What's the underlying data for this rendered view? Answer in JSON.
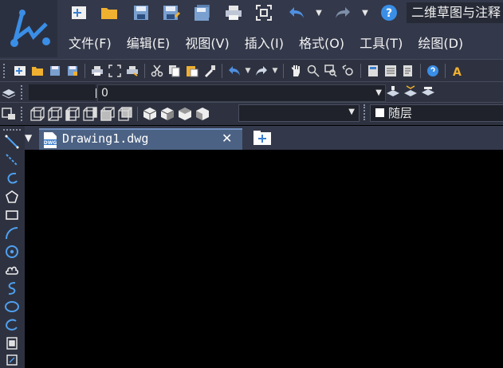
{
  "window": {
    "title": "二维草图与注释",
    "help_label": "?"
  },
  "menubar": {
    "items": [
      {
        "label": "文件(F)"
      },
      {
        "label": "编辑(E)"
      },
      {
        "label": "视图(V)"
      },
      {
        "label": "插入(I)"
      },
      {
        "label": "格式(O)"
      },
      {
        "label": "工具(T)"
      },
      {
        "label": "绘图(D)"
      }
    ]
  },
  "layer_bar": {
    "current_layer": "0"
  },
  "properties_bar": {
    "layer_value": "随层"
  },
  "tabs": [
    {
      "label": "Drawing1.dwg",
      "icon": "dwg-file-icon",
      "close": "✕"
    }
  ],
  "colors": {
    "titlebar": "#33384a",
    "toolbar": "#2e3240",
    "tab_active": "#4c6284",
    "canvas": "#000000",
    "accent": "#3a8ee6"
  }
}
